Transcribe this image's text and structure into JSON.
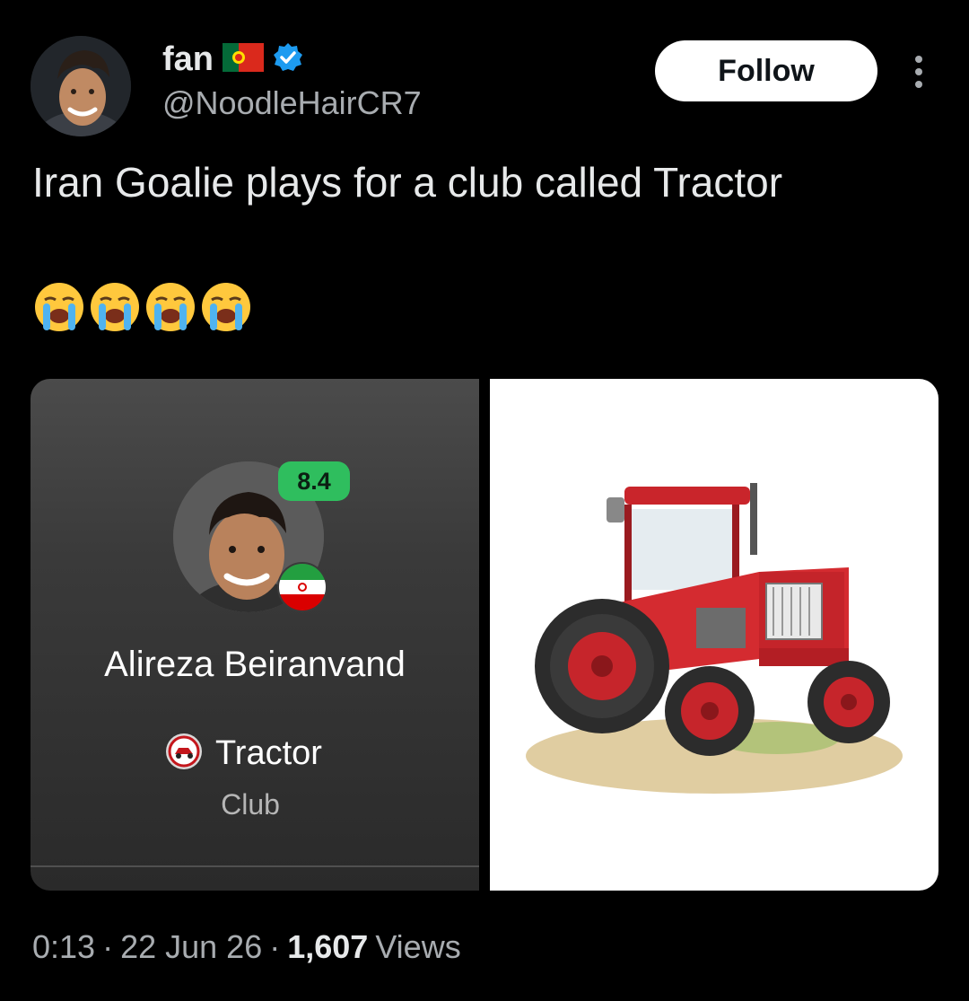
{
  "author": {
    "display_name": "fan",
    "handle": "@NoodleHairCR7",
    "flag_icon": "portugal-flag-icon",
    "verified_icon": "verified-badge-icon",
    "verified_color": "#1d9bf0"
  },
  "follow_button": {
    "label": "Follow"
  },
  "more_icon": "more-vertical-icon",
  "tweet": {
    "text": "Iran Goalie plays for a club called Tractor",
    "emojis": [
      "😭",
      "😭",
      "😭",
      "😭"
    ]
  },
  "player_card": {
    "rating": "8.4",
    "rating_color": "#2fbe5e",
    "player_name": "Alireza Beiranvand",
    "nationality_icon": "iran-flag-icon",
    "club_icon": "tractor-club-crest-icon",
    "club_name": "Tractor",
    "club_subtitle": "Club"
  },
  "tractor_image": {
    "icon": "red-tractor-illustration"
  },
  "meta": {
    "time": "0:13",
    "date": "22 Jun 26",
    "views_count": "1,607",
    "views_label": "Views",
    "separator": "·"
  }
}
